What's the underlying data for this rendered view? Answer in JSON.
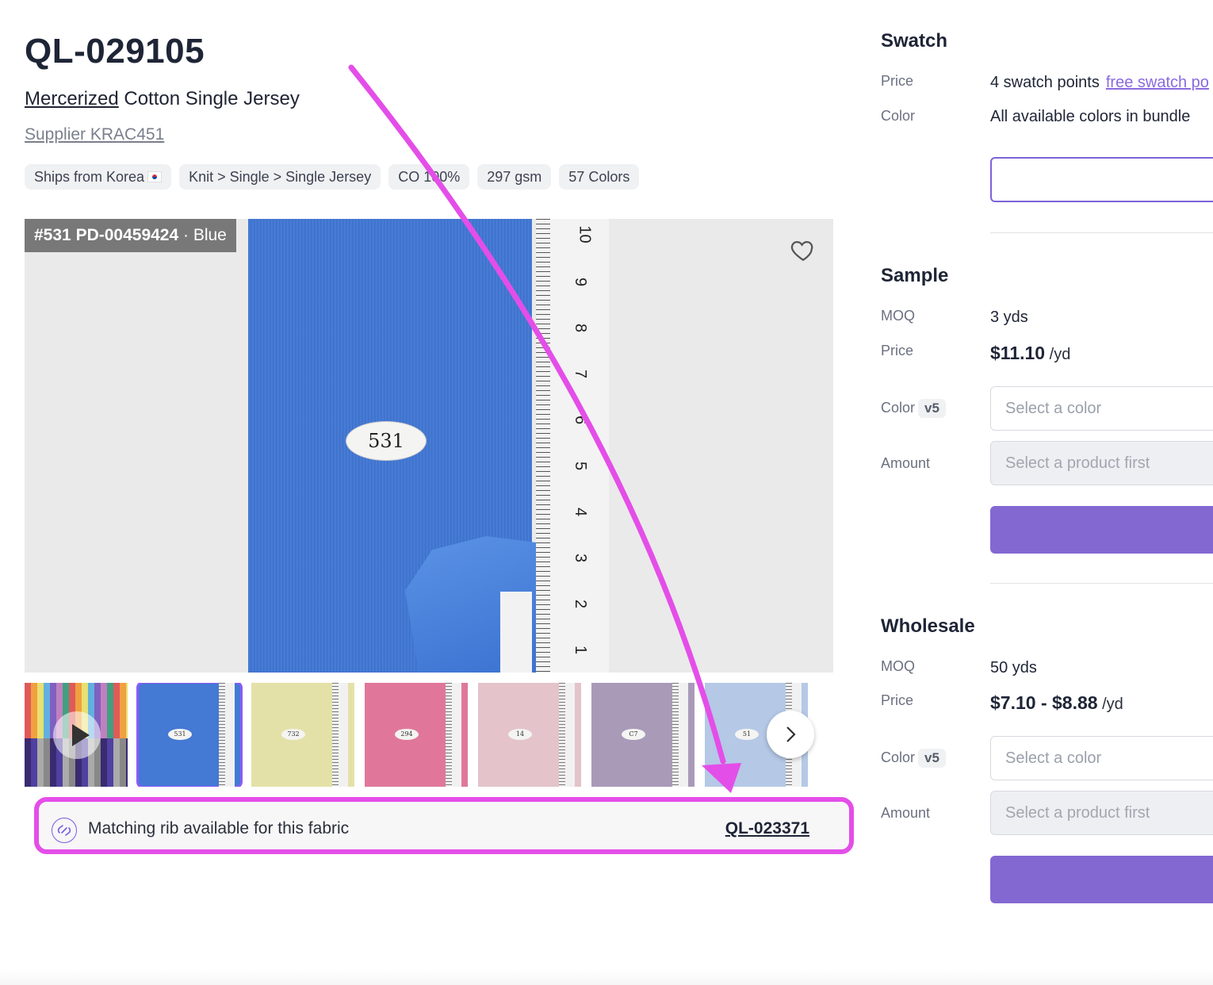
{
  "product": {
    "code": "QL-029105",
    "subtitle_underlined": "Mercerized",
    "subtitle_rest": " Cotton Single Jersey",
    "supplier": "Supplier KRAC451",
    "tags": [
      "Ships from Korea",
      "Knit > Single > Single Jersey",
      "CO 100%",
      "297 gsm",
      "57 Colors"
    ]
  },
  "image": {
    "label_number": "#531",
    "label_code": "PD-00459424",
    "label_color": " · Blue",
    "fabric_tag": "531",
    "ruler_numbers": [
      "10",
      "9",
      "8",
      "7",
      "6",
      "5",
      "4",
      "3",
      "2",
      "1"
    ]
  },
  "thumbnails": [
    {
      "type": "video",
      "color": "#8a86a0"
    },
    {
      "label": "531",
      "color": "#4479d4",
      "selected": true
    },
    {
      "label": "732",
      "color": "#e4e1a8"
    },
    {
      "label": "294",
      "color": "#e0779a"
    },
    {
      "label": "14",
      "color": "#e4c3ca"
    },
    {
      "label": "C7",
      "color": "#a99ab8"
    },
    {
      "label": "51",
      "color": "#b5c8e6"
    }
  ],
  "rib": {
    "text": "Matching rib available for this fabric",
    "link": "QL-023371"
  },
  "swatch": {
    "title": "Swatch",
    "price_label": "Price",
    "price_points": "4",
    "price_text": " swatch points",
    "price_link": "free swatch po",
    "color_label": "Color",
    "color_value": "All available colors in bundle"
  },
  "sample": {
    "title": "Sample",
    "moq_label": "MOQ",
    "moq_value": "3",
    "moq_unit": " yds",
    "price_label": "Price",
    "price_value": "$11.10",
    "price_unit": " /yd",
    "color_label": "Color",
    "color_badge": "v5",
    "color_placeholder": "Select a color",
    "amount_label": "Amount",
    "amount_placeholder": "Select a product first"
  },
  "wholesale": {
    "title": "Wholesale",
    "moq_label": "MOQ",
    "moq_value": "50",
    "moq_unit": " yds",
    "price_label": "Price",
    "price_value": "$7.10 - $8.88",
    "price_unit": " /yd",
    "color_label": "Color",
    "color_badge": "v5",
    "color_placeholder": "Select a color",
    "amount_label": "Amount",
    "amount_placeholder": "Select a product first"
  },
  "colors": {
    "accent": "#8468d2",
    "highlight": "#e44ee8"
  }
}
